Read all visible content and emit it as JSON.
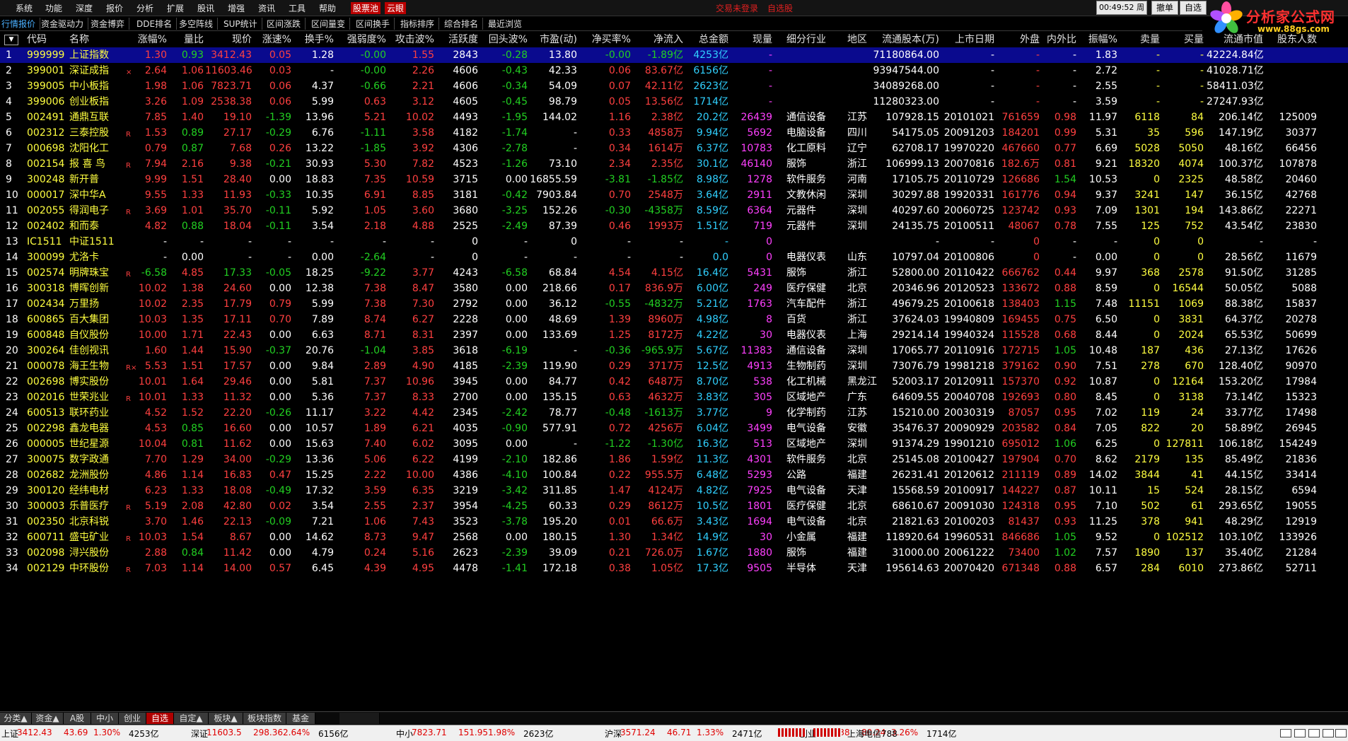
{
  "menu": [
    "系统",
    "功能",
    "深度",
    "报价",
    "分析",
    "扩展",
    "股讯",
    "增强",
    "资讯",
    "工具",
    "帮助"
  ],
  "menu_special": {
    "stock_pool": "股票池",
    "cloud": "云眼"
  },
  "status": {
    "login": "交易未登录",
    "watch": "自选股"
  },
  "clock": "00:49:52 周一",
  "buttons": {
    "withdraw": "撤单",
    "self_select": "自选"
  },
  "logo": {
    "text": "分析家公式网",
    "url": "www.88gs.com"
  },
  "tabs": [
    "行情报价",
    "资金驱动力",
    "资金博弈",
    "DDE排名",
    "多空阵线",
    "SUP统计",
    "区间涨跌",
    "区间量变",
    "区间换手",
    "指标排序",
    "综合排名",
    "最近浏览"
  ],
  "columns": [
    "代码",
    "名称",
    "涨幅%",
    "量比",
    "现价",
    "涨速%",
    "换手%",
    "强弱度%",
    "攻击波%",
    "活跃度",
    "回头波%",
    "市盈(动)",
    "净买率%",
    "净流入",
    "总金额",
    "现量",
    "细分行业",
    "地区",
    "流通股本(万)",
    "上市日期",
    "外盘",
    "内外比",
    "振幅%",
    "卖量",
    "买量",
    "流通市值",
    "股东人数"
  ],
  "rows": [
    {
      "n": "1",
      "code": "999999",
      "name": "上证指数",
      "mark": "",
      "v": [
        "1.30",
        "0.93",
        "3412.43",
        "0.05",
        "1.28",
        "-0.00",
        "1.55",
        "2843",
        "-0.28",
        "13.80",
        "-0.00",
        "-1.89亿",
        "4253亿",
        "-",
        "",
        "",
        "71180864.00",
        "-",
        "-",
        "-",
        "1.83",
        "-",
        "-",
        "42224.84亿",
        ""
      ]
    },
    {
      "n": "2",
      "code": "399001",
      "name": "深证成指",
      "mark": "×",
      "v": [
        "2.64",
        "1.06",
        "11603.46",
        "0.03",
        "-",
        "-0.00",
        "2.26",
        "4606",
        "-0.43",
        "42.33",
        "0.06",
        "83.67亿",
        "6156亿",
        "-",
        "",
        "",
        "93947544.00",
        "-",
        "-",
        "-",
        "2.72",
        "-",
        "-",
        "41028.71亿",
        ""
      ]
    },
    {
      "n": "3",
      "code": "399005",
      "name": "中小板指",
      "mark": "",
      "v": [
        "1.98",
        "1.06",
        "7823.71",
        "0.06",
        "4.37",
        "-0.66",
        "2.21",
        "4606",
        "-0.34",
        "54.09",
        "0.07",
        "42.11亿",
        "2623亿",
        "-",
        "",
        "",
        "34089268.00",
        "-",
        "-",
        "-",
        "2.55",
        "-",
        "-",
        "58411.03亿",
        ""
      ]
    },
    {
      "n": "4",
      "code": "399006",
      "name": "创业板指",
      "mark": "",
      "v": [
        "3.26",
        "1.09",
        "2538.38",
        "0.06",
        "5.99",
        "0.63",
        "3.12",
        "4605",
        "-0.45",
        "98.79",
        "0.05",
        "13.56亿",
        "1714亿",
        "-",
        "",
        "",
        "11280323.00",
        "-",
        "-",
        "-",
        "3.59",
        "-",
        "-",
        "27247.93亿",
        ""
      ]
    },
    {
      "n": "5",
      "code": "002491",
      "name": "通鼎互联",
      "mark": "",
      "v": [
        "7.85",
        "1.40",
        "19.10",
        "-1.39",
        "13.96",
        "5.21",
        "10.02",
        "4493",
        "-1.95",
        "144.02",
        "1.16",
        "2.38亿",
        "20.2亿",
        "26439",
        "通信设备",
        "江苏",
        "107928.15",
        "20101021",
        "761659",
        "0.98",
        "11.97",
        "6118",
        "84",
        "206.14亿",
        "125009"
      ]
    },
    {
      "n": "6",
      "code": "002312",
      "name": "三泰控股",
      "mark": "R",
      "v": [
        "1.53",
        "0.89",
        "27.17",
        "-0.29",
        "6.76",
        "-1.11",
        "3.58",
        "4182",
        "-1.74",
        "-",
        "0.33",
        "4858万",
        "9.94亿",
        "5692",
        "电脑设备",
        "四川",
        "54175.05",
        "20091203",
        "184201",
        "0.99",
        "5.31",
        "35",
        "596",
        "147.19亿",
        "30377"
      ]
    },
    {
      "n": "7",
      "code": "000698",
      "name": "沈阳化工",
      "mark": "",
      "v": [
        "0.79",
        "0.87",
        "7.68",
        "0.26",
        "13.22",
        "-1.85",
        "3.92",
        "4306",
        "-2.78",
        "-",
        "0.34",
        "1614万",
        "6.37亿",
        "10783",
        "化工原料",
        "辽宁",
        "62708.17",
        "19970220",
        "467660",
        "0.77",
        "6.69",
        "5028",
        "5050",
        "48.16亿",
        "66456"
      ]
    },
    {
      "n": "8",
      "code": "002154",
      "name": "报 喜 鸟",
      "mark": "R",
      "v": [
        "7.94",
        "2.16",
        "9.38",
        "-0.21",
        "30.93",
        "5.30",
        "7.82",
        "4523",
        "-1.26",
        "73.10",
        "2.34",
        "2.35亿",
        "30.1亿",
        "46140",
        "服饰",
        "浙江",
        "106999.13",
        "20070816",
        "182.6万",
        "0.81",
        "9.21",
        "18320",
        "4074",
        "100.37亿",
        "107878"
      ]
    },
    {
      "n": "9",
      "code": "300248",
      "name": "新开普",
      "mark": "",
      "v": [
        "9.99",
        "1.51",
        "28.40",
        "0.00",
        "18.83",
        "7.35",
        "10.59",
        "3715",
        "0.00",
        "16855.59",
        "-3.81",
        "-1.85亿",
        "8.98亿",
        "1278",
        "软件服务",
        "河南",
        "17105.75",
        "20110729",
        "126686",
        "1.54",
        "10.53",
        "0",
        "2325",
        "48.58亿",
        "20460"
      ]
    },
    {
      "n": "10",
      "code": "000017",
      "name": "深中华A",
      "mark": "",
      "v": [
        "9.55",
        "1.33",
        "11.93",
        "-0.33",
        "10.35",
        "6.91",
        "8.85",
        "3181",
        "-0.42",
        "7903.84",
        "0.70",
        "2548万",
        "3.64亿",
        "2911",
        "文教休闲",
        "深圳",
        "30297.88",
        "19920331",
        "161776",
        "0.94",
        "9.37",
        "3241",
        "147",
        "36.15亿",
        "42768"
      ]
    },
    {
      "n": "11",
      "code": "002055",
      "name": "得润电子",
      "mark": "R",
      "v": [
        "3.69",
        "1.01",
        "35.70",
        "-0.11",
        "5.92",
        "1.05",
        "3.60",
        "3680",
        "-3.25",
        "152.26",
        "-0.30",
        "-4358万",
        "8.59亿",
        "6364",
        "元器件",
        "深圳",
        "40297.60",
        "20060725",
        "123742",
        "0.93",
        "7.09",
        "1301",
        "194",
        "143.86亿",
        "22271"
      ]
    },
    {
      "n": "12",
      "code": "002402",
      "name": "和而泰",
      "mark": "",
      "v": [
        "4.82",
        "0.88",
        "18.04",
        "-0.11",
        "3.54",
        "2.18",
        "4.88",
        "2525",
        "-2.49",
        "87.39",
        "0.46",
        "1993万",
        "1.51亿",
        "719",
        "元器件",
        "深圳",
        "24135.75",
        "20100511",
        "48067",
        "0.78",
        "7.55",
        "125",
        "752",
        "43.54亿",
        "23830"
      ]
    },
    {
      "n": "13",
      "code": "IC1511",
      "name": "中证1511",
      "mark": "",
      "v": [
        "-",
        "-",
        "-",
        "-",
        "-",
        "-",
        "-",
        "0",
        "-",
        "0",
        "-",
        "-",
        "-",
        "0",
        "",
        "",
        "-",
        "-",
        "0",
        "-",
        "-",
        "0",
        "0",
        "-",
        "-"
      ]
    },
    {
      "n": "14",
      "code": "300099",
      "name": "尤洛卡",
      "mark": "",
      "v": [
        "-",
        "0.00",
        "-",
        "-",
        "0.00",
        "-2.64",
        "-",
        "0",
        "-",
        "-",
        "-",
        "-",
        "0.0",
        "0",
        "电器仪表",
        "山东",
        "10797.04",
        "20100806",
        "0",
        "-",
        "0.00",
        "0",
        "0",
        "28.56亿",
        "11679"
      ]
    },
    {
      "n": "15",
      "code": "002574",
      "name": "明牌珠宝",
      "mark": "R",
      "v": [
        "-6.58",
        "4.85",
        "17.33",
        "-0.05",
        "18.25",
        "-9.22",
        "3.77",
        "4243",
        "-6.58",
        "68.84",
        "4.54",
        "4.15亿",
        "16.4亿",
        "5431",
        "服饰",
        "浙江",
        "52800.00",
        "20110422",
        "666762",
        "0.44",
        "9.97",
        "368",
        "2578",
        "91.50亿",
        "31285"
      ]
    },
    {
      "n": "16",
      "code": "300318",
      "name": "博晖创新",
      "mark": "",
      "v": [
        "10.02",
        "1.38",
        "24.60",
        "0.00",
        "12.38",
        "7.38",
        "8.47",
        "3580",
        "0.00",
        "218.66",
        "0.17",
        "836.9万",
        "6.00亿",
        "249",
        "医疗保健",
        "北京",
        "20346.96",
        "20120523",
        "133672",
        "0.88",
        "8.59",
        "0",
        "16544",
        "50.05亿",
        "5088"
      ]
    },
    {
      "n": "17",
      "code": "002434",
      "name": "万里扬",
      "mark": "",
      "v": [
        "10.02",
        "2.35",
        "17.79",
        "0.79",
        "5.99",
        "7.38",
        "7.30",
        "2792",
        "0.00",
        "36.12",
        "-0.55",
        "-4832万",
        "5.21亿",
        "1763",
        "汽车配件",
        "浙江",
        "49679.25",
        "20100618",
        "138403",
        "1.15",
        "7.48",
        "11151",
        "1069",
        "88.38亿",
        "15837"
      ]
    },
    {
      "n": "18",
      "code": "600865",
      "name": "百大集团",
      "mark": "",
      "v": [
        "10.03",
        "1.35",
        "17.11",
        "0.70",
        "7.89",
        "8.74",
        "6.27",
        "2228",
        "0.00",
        "48.69",
        "1.39",
        "8960万",
        "4.98亿",
        "8",
        "百货",
        "浙江",
        "37624.03",
        "19940809",
        "169455",
        "0.75",
        "6.50",
        "0",
        "3831",
        "64.37亿",
        "20278"
      ]
    },
    {
      "n": "19",
      "code": "600848",
      "name": "自仪股份",
      "mark": "",
      "v": [
        "10.00",
        "1.71",
        "22.43",
        "0.00",
        "6.63",
        "8.71",
        "8.31",
        "2397",
        "0.00",
        "133.69",
        "1.25",
        "8172万",
        "4.22亿",
        "30",
        "电器仪表",
        "上海",
        "29214.14",
        "19940324",
        "115528",
        "0.68",
        "8.44",
        "0",
        "2024",
        "65.53亿",
        "50699"
      ]
    },
    {
      "n": "20",
      "code": "300264",
      "name": "佳创视讯",
      "mark": "",
      "v": [
        "1.60",
        "1.44",
        "15.90",
        "-0.37",
        "20.76",
        "-1.04",
        "3.85",
        "3618",
        "-6.19",
        "-",
        "-0.36",
        "-965.9万",
        "5.67亿",
        "11383",
        "通信设备",
        "深圳",
        "17065.77",
        "20110916",
        "172715",
        "1.05",
        "10.48",
        "187",
        "436",
        "27.13亿",
        "17626"
      ]
    },
    {
      "n": "21",
      "code": "000078",
      "name": "海王生物",
      "mark": "R×",
      "v": [
        "5.53",
        "1.51",
        "17.57",
        "0.00",
        "9.84",
        "2.89",
        "4.90",
        "4185",
        "-2.39",
        "119.90",
        "0.29",
        "3717万",
        "12.5亿",
        "4913",
        "生物制药",
        "深圳",
        "73076.79",
        "19981218",
        "379162",
        "0.90",
        "7.51",
        "278",
        "670",
        "128.40亿",
        "90970"
      ]
    },
    {
      "n": "22",
      "code": "002698",
      "name": "博实股份",
      "mark": "",
      "v": [
        "10.01",
        "1.64",
        "29.46",
        "0.00",
        "5.81",
        "7.37",
        "10.96",
        "3945",
        "0.00",
        "84.77",
        "0.42",
        "6487万",
        "8.70亿",
        "538",
        "化工机械",
        "黑龙江",
        "52003.17",
        "20120911",
        "157370",
        "0.92",
        "10.87",
        "0",
        "12164",
        "153.20亿",
        "17984"
      ]
    },
    {
      "n": "23",
      "code": "002016",
      "name": "世荣兆业",
      "mark": "R",
      "v": [
        "10.01",
        "1.33",
        "11.32",
        "0.00",
        "5.36",
        "7.37",
        "8.33",
        "2700",
        "0.00",
        "135.15",
        "0.63",
        "4632万",
        "3.83亿",
        "305",
        "区域地产",
        "广东",
        "64609.55",
        "20040708",
        "192693",
        "0.80",
        "8.45",
        "0",
        "3138",
        "73.14亿",
        "15323"
      ]
    },
    {
      "n": "24",
      "code": "600513",
      "name": "联环药业",
      "mark": "",
      "v": [
        "4.52",
        "1.52",
        "22.20",
        "-0.26",
        "11.17",
        "3.22",
        "4.42",
        "2345",
        "-2.42",
        "78.77",
        "-0.48",
        "-1613万",
        "3.77亿",
        "9",
        "化学制药",
        "江苏",
        "15210.00",
        "20030319",
        "87057",
        "0.95",
        "7.02",
        "119",
        "24",
        "33.77亿",
        "17498"
      ]
    },
    {
      "n": "25",
      "code": "002298",
      "name": "鑫龙电器",
      "mark": "",
      "v": [
        "4.53",
        "0.85",
        "16.60",
        "0.00",
        "10.57",
        "1.89",
        "6.21",
        "4035",
        "-0.90",
        "577.91",
        "0.72",
        "4256万",
        "6.04亿",
        "3499",
        "电气设备",
        "安徽",
        "35476.37",
        "20090929",
        "203582",
        "0.84",
        "7.05",
        "822",
        "20",
        "58.89亿",
        "26945"
      ]
    },
    {
      "n": "26",
      "code": "000005",
      "name": "世纪星源",
      "mark": "",
      "v": [
        "10.04",
        "0.81",
        "11.62",
        "0.00",
        "15.63",
        "7.40",
        "6.02",
        "3095",
        "0.00",
        "-",
        "-1.22",
        "-1.30亿",
        "16.3亿",
        "513",
        "区域地产",
        "深圳",
        "91374.29",
        "19901210",
        "695012",
        "1.06",
        "6.25",
        "0",
        "127811",
        "106.18亿",
        "154249"
      ]
    },
    {
      "n": "27",
      "code": "300075",
      "name": "数字政通",
      "mark": "",
      "v": [
        "7.70",
        "1.29",
        "34.00",
        "-0.29",
        "13.36",
        "5.06",
        "6.22",
        "4199",
        "-2.10",
        "182.86",
        "1.86",
        "1.59亿",
        "11.3亿",
        "4301",
        "软件服务",
        "北京",
        "25145.08",
        "20100427",
        "197904",
        "0.70",
        "8.62",
        "2179",
        "135",
        "85.49亿",
        "21836"
      ]
    },
    {
      "n": "28",
      "code": "002682",
      "name": "龙洲股份",
      "mark": "",
      "v": [
        "4.86",
        "1.14",
        "16.83",
        "0.47",
        "15.25",
        "2.22",
        "10.00",
        "4386",
        "-4.10",
        "100.84",
        "0.22",
        "955.5万",
        "6.48亿",
        "5293",
        "公路",
        "福建",
        "26231.41",
        "20120612",
        "211119",
        "0.89",
        "14.02",
        "3844",
        "41",
        "44.15亿",
        "33414"
      ]
    },
    {
      "n": "29",
      "code": "300120",
      "name": "经纬电材",
      "mark": "",
      "v": [
        "6.23",
        "1.33",
        "18.08",
        "-0.49",
        "17.32",
        "3.59",
        "6.35",
        "3219",
        "-3.42",
        "311.85",
        "1.47",
        "4124万",
        "4.82亿",
        "7925",
        "电气设备",
        "天津",
        "15568.59",
        "20100917",
        "144227",
        "0.87",
        "10.11",
        "15",
        "524",
        "28.15亿",
        "6594"
      ]
    },
    {
      "n": "30",
      "code": "300003",
      "name": "乐普医疗",
      "mark": "R",
      "v": [
        "5.19",
        "2.08",
        "42.80",
        "0.02",
        "3.54",
        "2.55",
        "2.37",
        "3954",
        "-4.25",
        "60.33",
        "0.29",
        "8612万",
        "10.5亿",
        "1801",
        "医疗保健",
        "北京",
        "68610.67",
        "20091030",
        "124318",
        "0.95",
        "7.10",
        "502",
        "61",
        "293.65亿",
        "19055"
      ]
    },
    {
      "n": "31",
      "code": "002350",
      "name": "北京科锐",
      "mark": "",
      "v": [
        "3.70",
        "1.46",
        "22.13",
        "-0.09",
        "7.21",
        "1.06",
        "7.43",
        "3523",
        "-3.78",
        "195.20",
        "0.01",
        "66.6万",
        "3.43亿",
        "1694",
        "电气设备",
        "北京",
        "21821.63",
        "20100203",
        "81437",
        "0.93",
        "11.25",
        "378",
        "941",
        "48.29亿",
        "12919"
      ]
    },
    {
      "n": "32",
      "code": "600711",
      "name": "盛屯矿业",
      "mark": "R",
      "v": [
        "10.03",
        "1.54",
        "8.67",
        "0.00",
        "14.62",
        "8.73",
        "9.47",
        "2568",
        "0.00",
        "180.15",
        "1.30",
        "1.34亿",
        "14.9亿",
        "30",
        "小金属",
        "福建",
        "118920.64",
        "19960531",
        "846686",
        "1.05",
        "9.52",
        "0",
        "102512",
        "103.10亿",
        "133926"
      ]
    },
    {
      "n": "33",
      "code": "002098",
      "name": "浔兴股份",
      "mark": "",
      "v": [
        "2.88",
        "0.84",
        "11.42",
        "0.00",
        "4.79",
        "0.24",
        "5.16",
        "2623",
        "-2.39",
        "39.09",
        "0.21",
        "726.0万",
        "1.67亿",
        "1880",
        "服饰",
        "福建",
        "31000.00",
        "20061222",
        "73400",
        "1.02",
        "7.57",
        "1890",
        "137",
        "35.40亿",
        "21284"
      ]
    },
    {
      "n": "34",
      "code": "002129",
      "name": "中环股份",
      "mark": "R",
      "v": [
        "7.03",
        "1.14",
        "14.00",
        "0.57",
        "6.45",
        "4.39",
        "4.95",
        "4478",
        "-1.41",
        "172.18",
        "0.38",
        "1.05亿",
        "17.3亿",
        "9505",
        "半导体",
        "天津",
        "195614.63",
        "20070420",
        "671348",
        "0.88",
        "6.57",
        "284",
        "6010",
        "273.86亿",
        "52711"
      ]
    }
  ],
  "bottom_tabs": [
    "分类▲",
    "资金▲",
    "A股",
    "中小",
    "创业",
    "自选",
    "自定▲",
    "板块▲",
    "板块指数",
    "基金"
  ],
  "ticker": [
    {
      "label": "上证",
      "price": "3412.43",
      "chg": "43.69",
      "pct": "1.30%",
      "amt": "4253亿"
    },
    {
      "label": "深证",
      "price": "11603.5",
      "chg": "298.36",
      "pct": "2.64%",
      "amt": "6156亿"
    },
    {
      "label": "中小",
      "price": "7823.71",
      "chg": "151.95",
      "pct": "1.98%",
      "amt": "2623亿"
    },
    {
      "label": "沪深",
      "price": "3571.24",
      "chg": "46.71",
      "pct": "1.33%",
      "amt": "2471亿"
    },
    {
      "label": "创业",
      "price": "2538.38",
      "chg": "80.24",
      "pct": "3.26%",
      "amt": "1714亿"
    }
  ],
  "server": "上海电信788"
}
